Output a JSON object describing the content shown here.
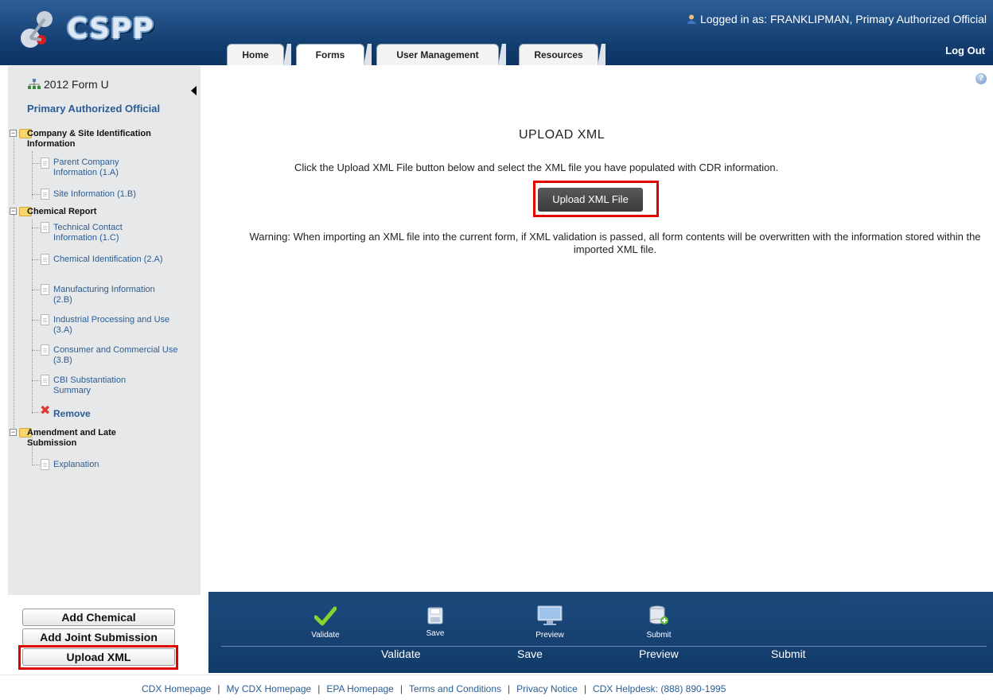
{
  "header": {
    "app_name": "CSPP",
    "login_text": "Logged in as: FRANKLIPMAN, Primary Authorized Official",
    "logout": "Log Out",
    "tabs": [
      {
        "label": "Home"
      },
      {
        "label": "Forms"
      },
      {
        "label": "User Management"
      },
      {
        "label": "Resources"
      }
    ]
  },
  "sidebar": {
    "form_title": "2012 Form U",
    "role": "Primary Authorized Official",
    "tree": {
      "section1": "Company & Site Identification Information",
      "parent_company": "Parent Company Information (1.A)",
      "site_info": "Site Information (1.B)",
      "section2": "Chemical Report",
      "technical_contact": "Technical Contact Information (1.C)",
      "chemical_id": "Chemical Identification (2.A)",
      "manufacturing": "Manufacturing Information (2.B)",
      "industrial": "Industrial Processing and Use (3.A)",
      "consumer": "Consumer and Commercial Use (3.B)",
      "cbi": "CBI Substantiation Summary",
      "remove": "Remove",
      "section3": "Amendment and Late Submission",
      "explanation": "Explanation"
    },
    "buttons": {
      "add_chemical": "Add Chemical",
      "add_joint": "Add Joint Submission",
      "upload_xml": "Upload XML"
    }
  },
  "main": {
    "title": "UPLOAD XML",
    "instruction": "Click the Upload XML File button below and select the XML file you have populated with CDR information.",
    "upload_button": "Upload XML File",
    "warning": "Warning: When importing an XML file into the current form, if XML validation is passed, all form contents will be overwritten with the information stored within the imported XML file."
  },
  "toolbar": {
    "icons": [
      {
        "caption": "Validate",
        "icon": "checkmark-icon"
      },
      {
        "caption": "Save",
        "icon": "floppy-icon"
      },
      {
        "caption": "Preview",
        "icon": "monitor-icon"
      },
      {
        "caption": "Submit",
        "icon": "database-add-icon"
      }
    ],
    "labels": [
      "Validate",
      "Save",
      "Preview",
      "Submit"
    ]
  },
  "footer": {
    "links": [
      "CDX Homepage",
      "My CDX Homepage",
      "EPA Homepage",
      "Terms and Conditions",
      "Privacy Notice",
      "CDX Helpdesk: (888) 890-1995"
    ]
  },
  "colors": {
    "header_bg": "#123d6f",
    "link": "#2a5d95",
    "highlight": "#e00000",
    "toolbar_bg": "#1a4574"
  }
}
